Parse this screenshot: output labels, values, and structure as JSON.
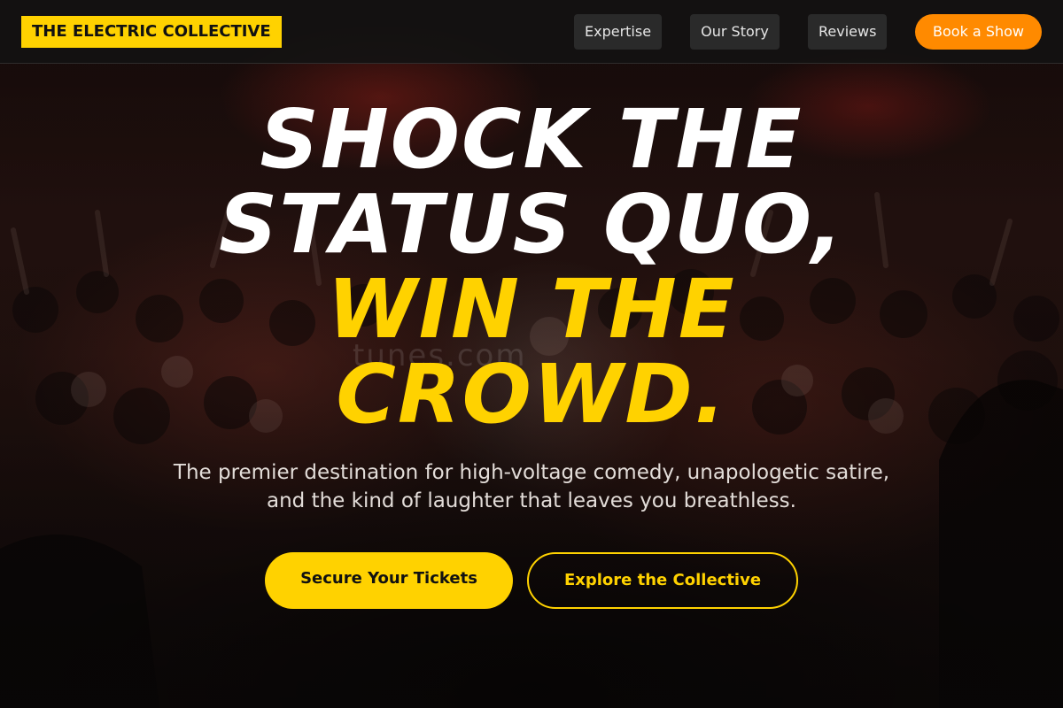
{
  "header": {
    "logo_text": "THE ELECTRIC COLLECTIVE",
    "nav": [
      {
        "label": "Expertise"
      },
      {
        "label": "Our Story"
      },
      {
        "label": "Reviews"
      }
    ],
    "cta_label": "Book a Show"
  },
  "hero": {
    "headline_lines": [
      "SHOCK THE",
      "STATUS QUO,",
      "WIN THE",
      "CROWD."
    ],
    "subtext_lines": [
      "The premier destination for high-voltage comedy, unapologetic satire,",
      "and the kind of laughter that leaves you breathless."
    ],
    "primary_cta": "Secure Your Tickets",
    "secondary_cta": "Explore the Collective",
    "background_image": "concert-crowd-photo"
  },
  "colors": {
    "accent_yellow": "#ffd200",
    "accent_orange": "#ff8a00",
    "header_bg": "#141212",
    "nav_button_bg": "#2a2a2a"
  }
}
